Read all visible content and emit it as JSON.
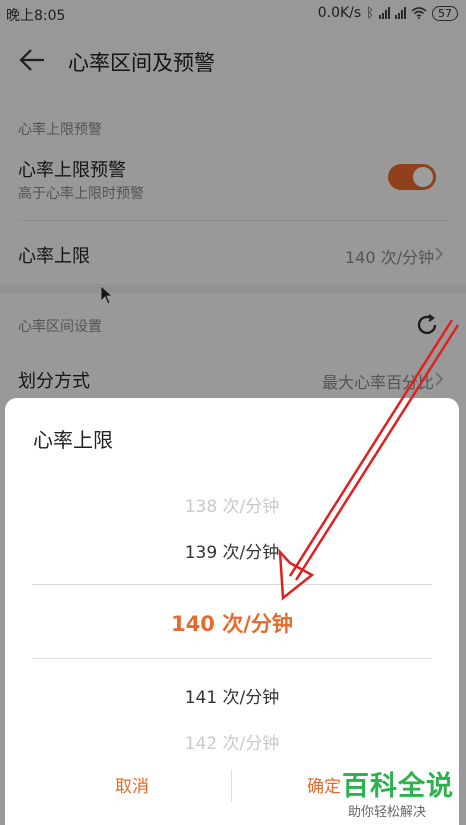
{
  "status_bar": {
    "time": "晚上8:05",
    "net_speed": "0.0K/s",
    "battery": "57"
  },
  "app_bar": {
    "title": "心率区间及预警"
  },
  "warning_section": {
    "header": "心率上限预警",
    "toggle_row": {
      "title": "心率上限预警",
      "subtitle": "高于心率上限时预警",
      "enabled": true
    },
    "limit_row": {
      "title": "心率上限",
      "value": "140 次/分钟"
    }
  },
  "zone_section": {
    "header": "心率区间设置",
    "method_row": {
      "title": "划分方式",
      "value": "最大心率百分比"
    }
  },
  "dialog": {
    "title": "心率上限",
    "picker": [
      {
        "label": "138 次/分钟",
        "state": "far"
      },
      {
        "label": "139 次/分钟",
        "state": "near"
      },
      {
        "label": "140 次/分钟",
        "state": "selected"
      },
      {
        "label": "141 次/分钟",
        "state": "near"
      },
      {
        "label": "142 次/分钟",
        "state": "far"
      }
    ],
    "cancel_label": "取消",
    "confirm_label": "确定"
  },
  "watermark": {
    "brand": "百科全说",
    "slogan": "助你轻松解决"
  },
  "colors": {
    "accent": "#e8692b",
    "annotation_arrow": "#e02020",
    "watermark_green": "#2bb24c"
  }
}
